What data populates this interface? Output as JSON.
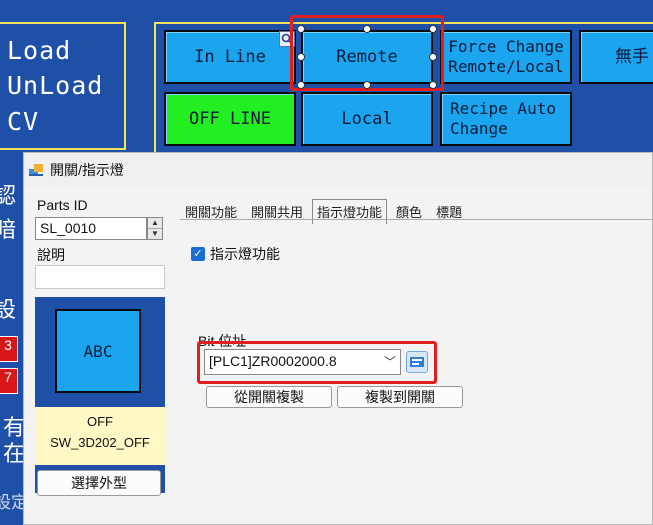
{
  "hmi": {
    "left_labels": [
      "Load",
      "UnLoad",
      "CV"
    ],
    "buttons": {
      "in_line": "In Line",
      "remote": "Remote",
      "force_change": "Force Change Remote/Local",
      "manual": "無手",
      "off_line": "OFF LINE",
      "local": "Local",
      "recipe_auto": "Recipe Auto Change"
    },
    "side_chars": [
      "認",
      "暗",
      "設",
      "有",
      "在",
      "設定"
    ],
    "side_red": [
      "3",
      "7"
    ]
  },
  "dialog": {
    "title": "開關/指示燈",
    "parts_id_label": "Parts ID",
    "parts_id_value": "SL_0010",
    "description_label": "說明",
    "description_value": "",
    "preview_button_text": "ABC",
    "preview_state": "OFF",
    "preview_shape_name": "SW_3D202_OFF",
    "select_shape_button": "選擇外型",
    "tabs": [
      "開關功能",
      "開關共用",
      "指示燈功能",
      "顏色",
      "標題"
    ],
    "active_tab": 2,
    "indicator_checkbox_label": "指示燈功能",
    "indicator_checked": true,
    "bit_address_label": "Bit 位址",
    "bit_address_value": "[PLC1]ZR0002000.8",
    "copy_from_switch": "從開關複製",
    "copy_to_switch": "複製到開關"
  },
  "colors": {
    "hmi_background": "#1f50a8",
    "button_blue": "#1aa5ee",
    "button_green": "#22ee22",
    "highlight_red": "#e02020",
    "panel_border": "#f2e15a"
  }
}
